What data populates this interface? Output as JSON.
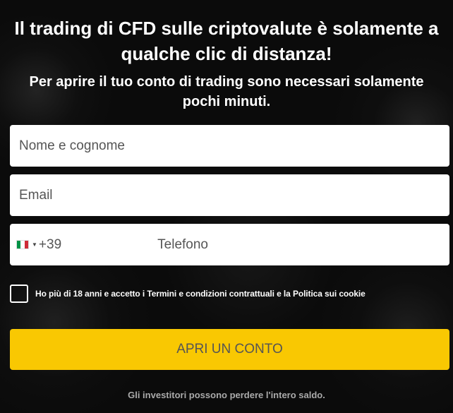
{
  "headline": "Il trading di CFD sulle criptovalute è solamente a qualche clic di distanza!",
  "subheadline": "Per aprire il tuo conto di trading sono necessari solamente pochi minuti.",
  "form": {
    "name_placeholder": "Nome e cognome",
    "email_placeholder": "Email",
    "phone": {
      "country_flag": "italy-flag-icon",
      "dial_code": "+39",
      "placeholder": "Telefono"
    },
    "consent_label": "Ho più di 18 anni e accetto i Termini e condizioni contrattuali e la Politica sui cookie",
    "consent_checked": false,
    "submit_label": "APRI UN CONTO"
  },
  "disclaimer": "Gli investitori possono perdere l'intero saldo.",
  "colors": {
    "background": "#0b0b0b",
    "accent_button": "#f9c802",
    "text": "#ffffff",
    "disclaimer_text": "#aaaaaa"
  }
}
